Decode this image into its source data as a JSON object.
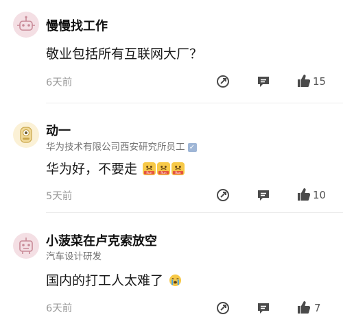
{
  "comments": [
    {
      "name": "慢慢找工作",
      "subtitle": "",
      "text": "敬业包括所有互联网大厂？",
      "time": "6天前",
      "likes": "15"
    },
    {
      "name": "动一",
      "subtitle": "华为技术有限公司西安研究所员工",
      "verified_mark": "✓",
      "text": "华为好，不要走",
      "time": "5天前",
      "likes": "10",
      "emoji_caption": "Run"
    },
    {
      "name": "小菠菜在卢克索放空",
      "subtitle": "汽车设计研发",
      "text": "国内的打工人太难了",
      "time": "6天前",
      "likes": "7"
    }
  ],
  "icons": {
    "share": "share-icon",
    "comment": "comment-icon",
    "like": "thumbs-up-icon"
  },
  "colors": {
    "avatar_bg": "#f4dfe4",
    "text_primary": "#1a1a1a",
    "text_secondary": "#707070",
    "time": "#9a9a9a",
    "icon": "#4a4a4a"
  }
}
